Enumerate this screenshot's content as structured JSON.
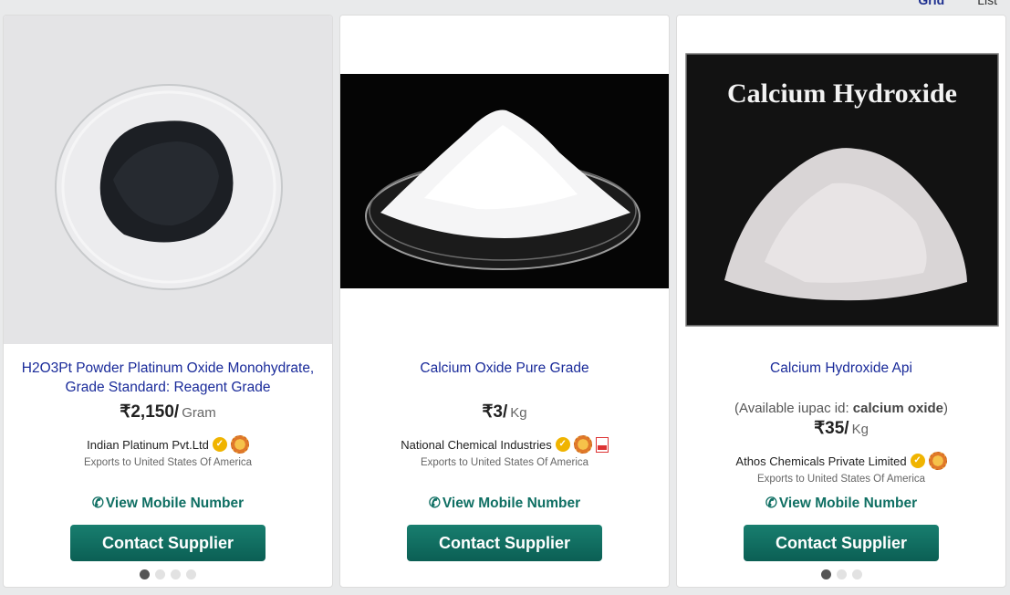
{
  "view_toggle": {
    "grid_label": "Grid",
    "list_label": "List"
  },
  "products": [
    {
      "title": "H2O3Pt Powder Platinum Oxide Monohydrate, Grade Standard: Reagent Grade",
      "price": "₹2,150/",
      "unit": "Gram",
      "supplier": "Indian Platinum Pvt.Ltd",
      "exports": "Exports to United States Of America",
      "mobile_label": "View Mobile Number",
      "contact_label": "Contact Supplier"
    },
    {
      "title": "Calcium Oxide Pure Grade",
      "price": "₹3/",
      "unit": "Kg",
      "supplier": "National Chemical Industries",
      "exports": "Exports to United States Of America",
      "mobile_label": "View Mobile Number",
      "contact_label": "Contact Supplier"
    },
    {
      "title": "Calcium Hydroxide Api",
      "iupac_prefix": "(Available iupac id: ",
      "iupac_value": "calcium oxide",
      "iupac_suffix": ")",
      "price": "₹35/",
      "unit": "Kg",
      "image_text": "Calcium Hydroxide",
      "supplier": "Athos Chemicals Private Limited",
      "exports": "Exports to United States Of America",
      "mobile_label": "View Mobile Number",
      "contact_label": "Contact Supplier"
    }
  ],
  "icons": {
    "verified": "verified-badge-icon",
    "seal": "trust-seal-icon",
    "pdf": "pdf-icon",
    "phone": "phone-icon"
  },
  "colors": {
    "title": "#1a2b9a",
    "mobile": "#0f6f63",
    "button": "#0b5f54"
  }
}
